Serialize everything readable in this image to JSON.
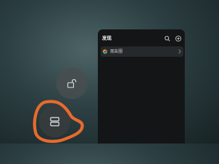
{
  "panel": {
    "title": "发现",
    "icons": [
      "search-icon",
      "plus-circle-icon"
    ],
    "rows": [
      {
        "label": "朋友圈",
        "icon": "moments-icon"
      }
    ]
  },
  "floating_buttons": [
    {
      "icon": "unlock-icon"
    },
    {
      "icon": "split-window-icon"
    }
  ],
  "annotation": {
    "color": "#e86a2c"
  }
}
